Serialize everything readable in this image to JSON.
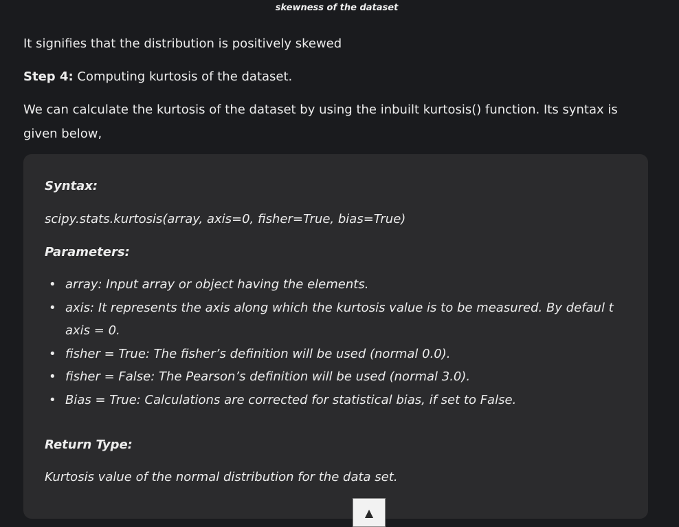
{
  "caption": "skewness of the dataset",
  "paragraphs": {
    "p1": "It signifies that the distribution is positively skewed",
    "step_label": "Step 4:",
    "step_text": " Computing kurtosis of the dataset.",
    "p3": "We can calculate the kurtosis of the dataset by using the inbuilt kurtosis() function. Its syntax is given below,"
  },
  "box": {
    "syntax_heading": "Syntax:",
    "syntax_line": "scipy.stats.kurtosis(array, axis=0, fisher=True, bias=True)",
    "parameters_heading": "Parameters:",
    "parameters": [
      "array: Input array or object having the elements.",
      "axis: It represents the axis along which the kurtosis value is to be measured. By defaul t axis = 0.",
      "fisher = True: The fisher’s definition will be used (normal 0.0).",
      "fisher =  False: The Pearson’s definition will be used (normal 3.0).",
      "Bias = True: Calculations are corrected for statistical bias, if set to False."
    ],
    "return_heading": "Return Type:",
    "return_line": "Kurtosis value of the normal distribution for the data set."
  },
  "scroll_top": {
    "icon": "up-triangle-icon",
    "glyph": "▲"
  }
}
